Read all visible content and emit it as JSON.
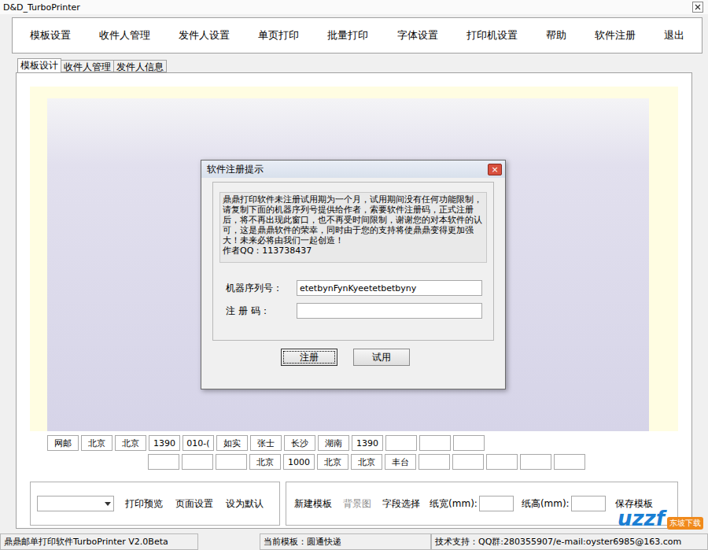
{
  "window": {
    "title": "D&D_TurboPrinter"
  },
  "toolbar": [
    "模板设置",
    "收件人管理",
    "发件人设置",
    "单页打印",
    "批量打印",
    "字体设置",
    "打印机设置",
    "帮助",
    "软件注册",
    "退出"
  ],
  "tabs": [
    {
      "label": "模板设计",
      "selected": true
    },
    {
      "label": "收件人管理",
      "selected": false
    },
    {
      "label": "发件人信息",
      "selected": false
    }
  ],
  "field_rows": [
    [
      "网邮",
      "北京",
      "北京",
      "1390",
      "010-(",
      "如实",
      "张士",
      "长沙",
      "湖南",
      "1390",
      "",
      "",
      ""
    ],
    [
      "",
      "",
      "",
      "北京",
      "1000",
      "北京",
      "北京",
      "丰台",
      "",
      "",
      "",
      "",
      ""
    ]
  ],
  "dialog": {
    "title": "软件注册提示",
    "close": "×",
    "message": "鼎鼎打印软件未注册试用期为一个月，试用期间没有任何功能限制，请复制下面的机器序列号提供给作者，索要软件注册码，正式注册后，将不再出现此窗口，也不再受时间限制，谢谢您的对本软件的认可，这是鼎鼎软件的荣幸，同时由于您的支持将使鼎鼎变得更加强大！未来必将由我们一起创造！",
    "author": "作者QQ：113738437",
    "fields": [
      {
        "label": "机器序列号：",
        "value": "etetbynFynKyeetetbetbyny"
      },
      {
        "label": "注 册 码：",
        "value": ""
      }
    ],
    "buttons": [
      {
        "label": "注册",
        "focused": true
      },
      {
        "label": "试用",
        "focused": false
      }
    ]
  },
  "bottom_left": {
    "dropdown": "",
    "buttons": [
      "打印预览",
      "页面设置",
      "设为默认"
    ]
  },
  "bottom_right": [
    {
      "kind": "button",
      "label": "新建模板",
      "disabled": false
    },
    {
      "kind": "button",
      "label": "背景图",
      "disabled": true
    },
    {
      "kind": "button",
      "label": "字段选择",
      "disabled": false
    },
    {
      "kind": "input",
      "label": "纸宽(mm):",
      "value": ""
    },
    {
      "kind": "input",
      "label": "纸高(mm):",
      "value": ""
    },
    {
      "kind": "button",
      "label": "保存模板",
      "disabled": false
    }
  ],
  "status_bar": [
    "鼎鼎邮单打印软件TurboPrinter V2.0Beta",
    "当前模板：圆通快递",
    "技术支持：QQ群:280355907/e-mail:oyster6985@163.com"
  ],
  "watermark": {
    "logo": "uzzf",
    "sub": "东坡下载"
  }
}
